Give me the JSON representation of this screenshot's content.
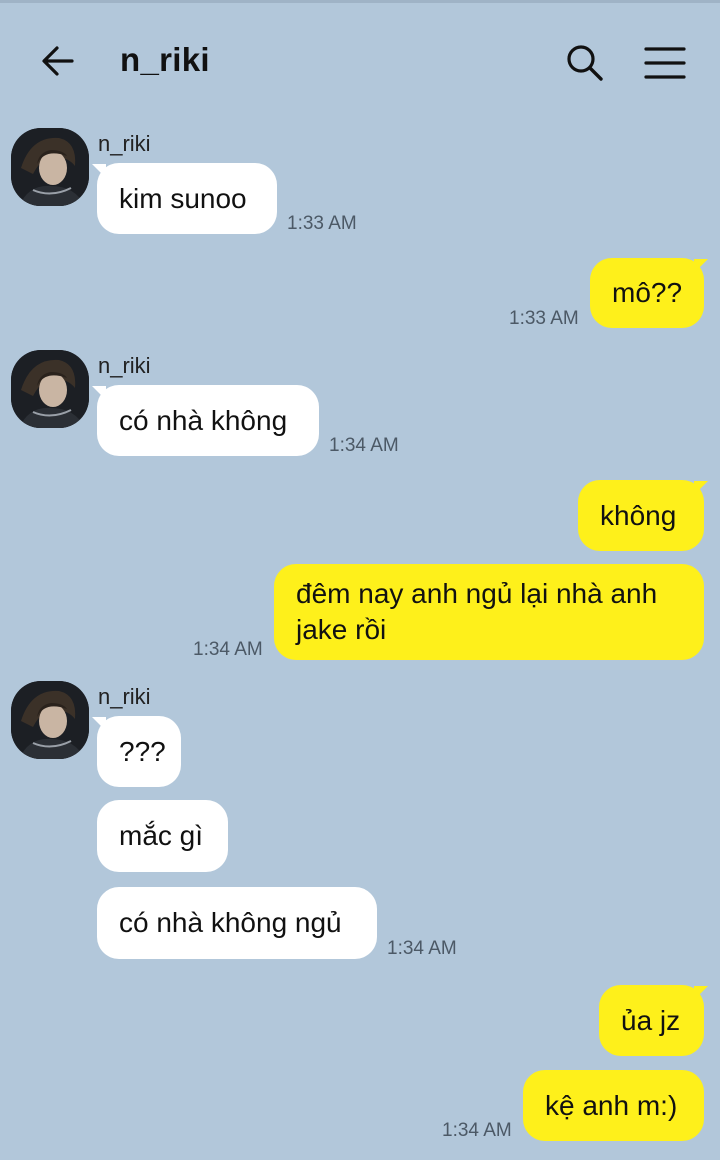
{
  "header": {
    "title": "n_riki",
    "back_icon": "back-arrow-icon",
    "search_icon": "search-icon",
    "menu_icon": "menu-icon"
  },
  "colors": {
    "background": "#b2c7da",
    "incoming_bubble": "#ffffff",
    "outgoing_bubble": "#fef01b"
  },
  "messages": [
    {
      "sender": "n_riki",
      "text": "kim sunoo",
      "time": "1:33 AM"
    },
    {
      "text": "mô??",
      "time": "1:33 AM"
    },
    {
      "sender": "n_riki",
      "text": "có nhà không",
      "time": "1:34 AM"
    },
    {
      "text": "không"
    },
    {
      "text": "đêm nay anh ngủ lại nhà anh jake rồi",
      "time": "1:34 AM"
    },
    {
      "sender": "n_riki",
      "text": "???"
    },
    {
      "text": "mắc gì"
    },
    {
      "text": "có nhà không ngủ",
      "time": "1:34 AM"
    },
    {
      "text": "ủa jz"
    },
    {
      "text": "kệ anh m:)",
      "time": "1:34 AM"
    }
  ]
}
